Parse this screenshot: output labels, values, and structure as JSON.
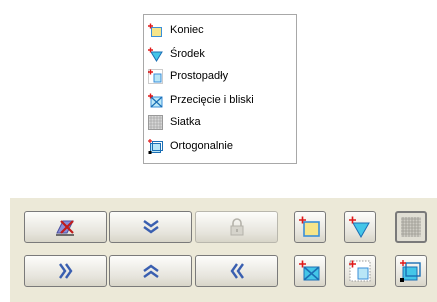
{
  "snap_menu": {
    "items": [
      {
        "label": "Koniec",
        "icon": "snap-end-icon"
      },
      {
        "label": "Środek",
        "icon": "snap-midpoint-icon"
      },
      {
        "label": "Prostopadły",
        "icon": "snap-perpendicular-icon"
      },
      {
        "label": "Przecięcie i bliski",
        "icon": "snap-intersection-icon"
      },
      {
        "label": "Siatka",
        "icon": "snap-grid-icon"
      },
      {
        "label": "Ortogonalnie",
        "icon": "snap-orthogonal-icon"
      }
    ]
  },
  "toolbar": {
    "nav_buttons": [
      {
        "icon": "delete-icon",
        "enabled": true
      },
      {
        "icon": "double-chevron-down-icon",
        "enabled": true
      },
      {
        "icon": "lock-icon",
        "enabled": false
      },
      {
        "icon": "double-chevron-right-icon",
        "enabled": true
      },
      {
        "icon": "double-chevron-up-icon",
        "enabled": true
      },
      {
        "icon": "double-chevron-left-icon",
        "enabled": true
      }
    ],
    "snap_buttons": [
      {
        "icon": "snap-end-icon",
        "pressed": false
      },
      {
        "icon": "snap-midpoint-icon",
        "pressed": false
      },
      {
        "icon": "snap-grid-icon",
        "pressed": true
      },
      {
        "icon": "snap-intersection-icon",
        "pressed": false
      },
      {
        "icon": "snap-perpendicular-icon",
        "pressed": false
      },
      {
        "icon": "snap-orthogonal-icon",
        "pressed": false
      }
    ]
  },
  "colors": {
    "toolbar_bg": "#ece9d8",
    "icon_blue": "#3a8fd8",
    "icon_yellow": "#f6e58a",
    "icon_cyan": "#44c6e8",
    "icon_red": "#e01818"
  }
}
